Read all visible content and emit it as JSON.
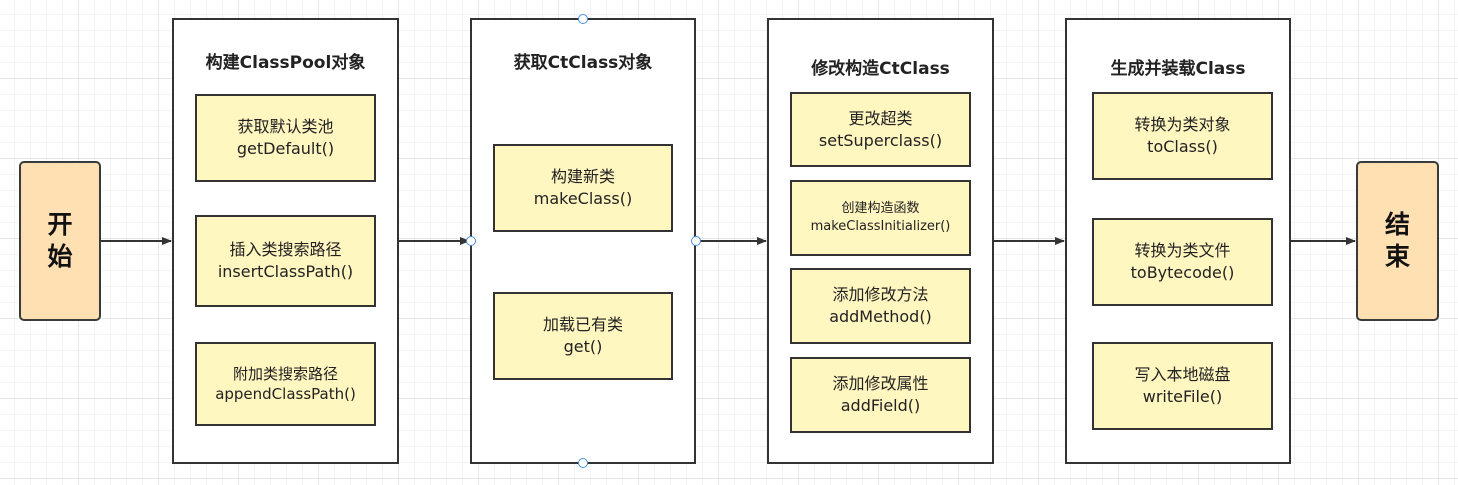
{
  "start": {
    "label": "开始"
  },
  "end": {
    "label": "结束"
  },
  "stages": [
    {
      "title": "构建ClassPool对象",
      "steps": [
        {
          "text": "获取默认类池",
          "code": "getDefault()"
        },
        {
          "text": "插入类搜索路径",
          "code": "insertClassPath()"
        },
        {
          "text": "附加类搜索路径",
          "code": "appendClassPath()"
        }
      ]
    },
    {
      "title": "获取CtClass对象",
      "steps": [
        {
          "text": "构建新类",
          "code": "makeClass()"
        },
        {
          "text": "加载已有类",
          "code": "get()"
        }
      ]
    },
    {
      "title": "修改构造CtClass",
      "steps": [
        {
          "text": "更改超类",
          "code": "setSuperclass()"
        },
        {
          "text": "创建构造函数",
          "code": "makeClassInitializer()"
        },
        {
          "text": "添加修改方法",
          "code": "addMethod()"
        },
        {
          "text": "添加修改属性",
          "code": "addField()"
        }
      ]
    },
    {
      "title": "生成并装载Class",
      "steps": [
        {
          "text": "转换为类对象",
          "code": "toClass()"
        },
        {
          "text": "转换为类文件",
          "code": "toBytecode()"
        },
        {
          "text": "写入本地磁盘",
          "code": "writeFile()"
        }
      ]
    }
  ],
  "colors": {
    "terminal_fill": "#ffe0b3",
    "step_fill": "#fff6c0",
    "stroke": "#333333",
    "selection_handle": "#4a8fd6"
  }
}
